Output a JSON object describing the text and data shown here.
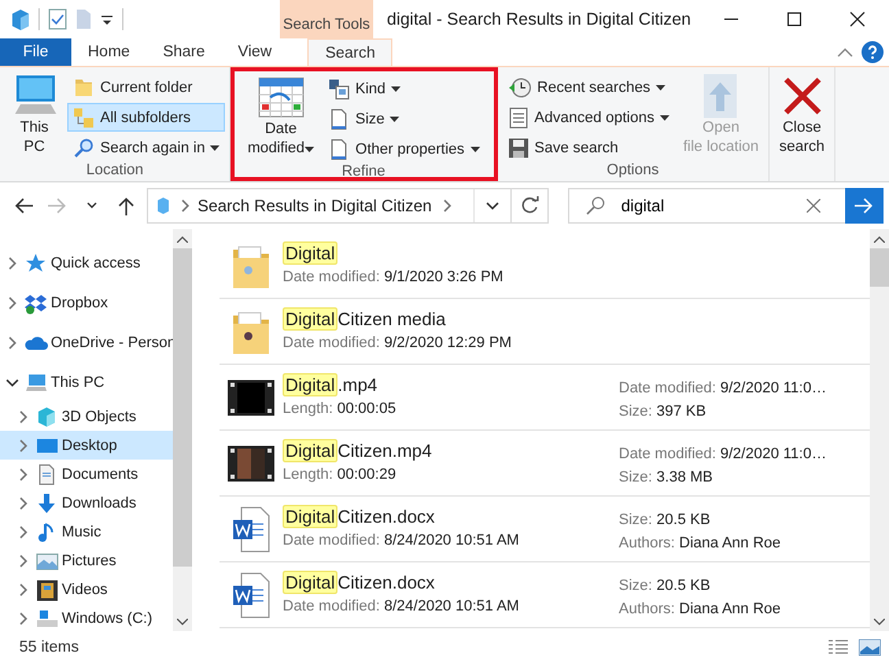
{
  "window": {
    "title": "digital - Search Results in Digital Citizen",
    "context_tab": "Search Tools"
  },
  "tabs": [
    {
      "label": "File",
      "kind": "file",
      "selected": false
    },
    {
      "label": "Home",
      "kind": "tab",
      "selected": false
    },
    {
      "label": "Share",
      "kind": "tab",
      "selected": false
    },
    {
      "label": "View",
      "kind": "tab",
      "selected": false
    },
    {
      "label": "Search",
      "kind": "tab",
      "selected": true
    }
  ],
  "ribbon": {
    "groups": [
      {
        "label": "Location",
        "highlighted": false,
        "columns": [
          {
            "kind": "large",
            "items": [
              {
                "label": "This PC",
                "dropdown": false,
                "disabled": false
              }
            ]
          },
          {
            "kind": "stack",
            "items": [
              {
                "label": "Current folder",
                "dropdown": false,
                "selected": false,
                "disabled": false
              },
              {
                "label": "All subfolders",
                "dropdown": false,
                "selected": true,
                "disabled": false
              },
              {
                "label": "Search again in",
                "dropdown": true,
                "selected": false,
                "disabled": false
              }
            ]
          }
        ]
      },
      {
        "label": "Refine",
        "highlighted": true,
        "columns": [
          {
            "kind": "large",
            "items": [
              {
                "label": "Date modified",
                "dropdown": true,
                "disabled": false
              }
            ]
          },
          {
            "kind": "stack",
            "items": [
              {
                "label": "Kind",
                "dropdown": true,
                "disabled": false
              },
              {
                "label": "Size",
                "dropdown": true,
                "disabled": false
              },
              {
                "label": "Other properties",
                "dropdown": true,
                "disabled": false
              }
            ]
          }
        ]
      },
      {
        "label": "Options",
        "highlighted": false,
        "columns": [
          {
            "kind": "stack",
            "items": [
              {
                "label": "Recent searches",
                "dropdown": true,
                "disabled": false
              },
              {
                "label": "Advanced options",
                "dropdown": true,
                "disabled": false
              },
              {
                "label": "Save search",
                "dropdown": false,
                "disabled": false
              }
            ]
          },
          {
            "kind": "large",
            "items": [
              {
                "label": "Open file location",
                "dropdown": false,
                "disabled": true
              }
            ]
          }
        ]
      },
      {
        "highlighted": false,
        "columns": [
          {
            "kind": "large",
            "items": [
              {
                "label": "Close search",
                "dropdown": false,
                "disabled": false
              }
            ]
          }
        ]
      }
    ]
  },
  "address": {
    "path": "Search Results in Digital Citizen"
  },
  "search": {
    "value": "digital"
  },
  "sidebar": {
    "items": [
      {
        "label": "Quick access",
        "expanded": false,
        "selected": false
      },
      {
        "label": "Dropbox",
        "expanded": false,
        "selected": false
      },
      {
        "label": "OneDrive - Person",
        "expanded": false,
        "selected": false
      },
      {
        "label": "This PC",
        "expanded": true,
        "selected": false,
        "children": [
          {
            "label": "3D Objects",
            "expanded": false,
            "selected": false
          },
          {
            "label": "Desktop",
            "expanded": false,
            "selected": true
          },
          {
            "label": "Documents",
            "expanded": false,
            "selected": false
          },
          {
            "label": "Downloads",
            "expanded": false,
            "selected": false
          },
          {
            "label": "Music",
            "expanded": false,
            "selected": false
          },
          {
            "label": "Pictures",
            "expanded": false,
            "selected": false
          },
          {
            "label": "Videos",
            "expanded": false,
            "selected": false
          },
          {
            "label": "Windows (C:)",
            "expanded": false,
            "selected": false
          }
        ]
      }
    ]
  },
  "files": [
    {
      "kind": "folder",
      "match": "Digital",
      "details": [
        {
          "label": "Date modified:",
          "value": "9/1/2020 3:26 PM"
        }
      ]
    },
    {
      "kind": "folder",
      "match": "Digital",
      "rest": " Citizen media",
      "details": [
        {
          "label": "Date modified:",
          "value": "9/2/2020 12:29 PM"
        }
      ]
    },
    {
      "kind": "video",
      "match": "Digital",
      "rest": ".mp4",
      "details": [
        {
          "label": "Length:",
          "value": "00:00:05"
        }
      ],
      "side": [
        {
          "label": "Date modified:",
          "value": "9/2/2020 11:0…"
        },
        {
          "label": "Size:",
          "value": "397 KB"
        }
      ]
    },
    {
      "kind": "video",
      "match": "Digital",
      "rest": " Citizen.mp4",
      "details": [
        {
          "label": "Length:",
          "value": "00:00:29"
        }
      ],
      "side": [
        {
          "label": "Date modified:",
          "value": "9/2/2020 11:0…"
        },
        {
          "label": "Size:",
          "value": "3.38 MB"
        }
      ]
    },
    {
      "kind": "document",
      "match": "Digital",
      "rest": " Citizen.docx",
      "details": [
        {
          "label": "Date modified:",
          "value": "8/24/2020 10:51 AM"
        }
      ],
      "side": [
        {
          "label": "Size:",
          "value": "20.5 KB"
        },
        {
          "label": "Authors:",
          "value": "Diana Ann Roe"
        }
      ]
    },
    {
      "kind": "document",
      "match": "Digital",
      "rest": " Citizen.docx",
      "details": [
        {
          "label": "Date modified:",
          "value": "8/24/2020 10:51 AM"
        }
      ],
      "side": [
        {
          "label": "Size:",
          "value": "20.5 KB"
        },
        {
          "label": "Authors:",
          "value": "Diana Ann Roe"
        }
      ]
    }
  ],
  "status_bar": {
    "count": "55 items"
  }
}
